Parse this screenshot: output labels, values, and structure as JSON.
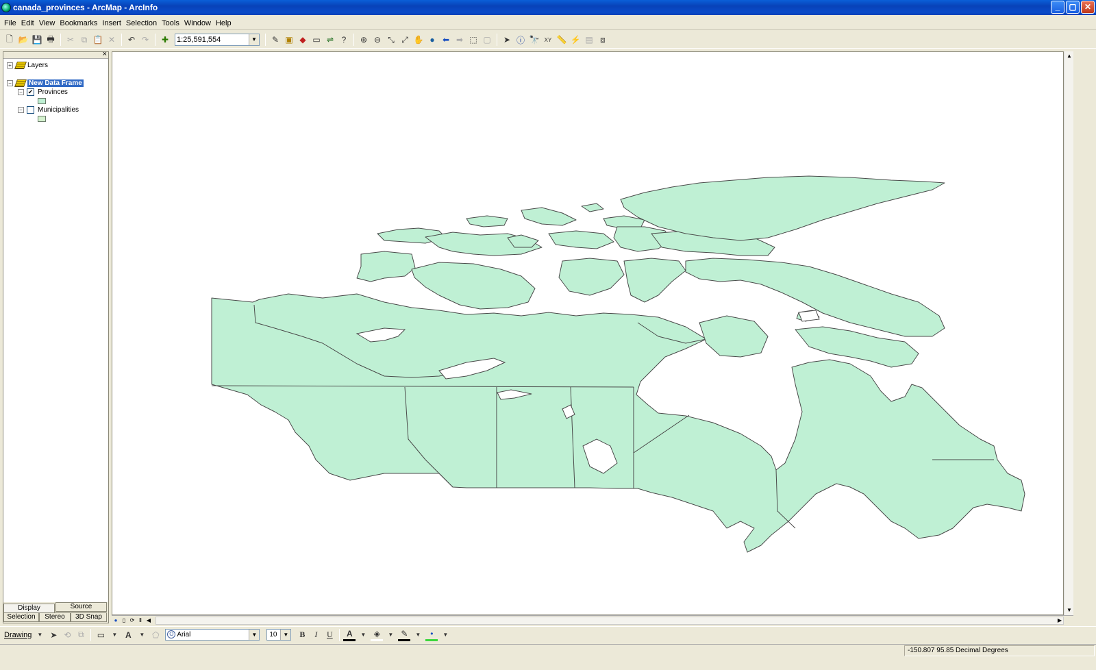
{
  "window": {
    "title": "canada_provinces - ArcMap - ArcInfo",
    "minimize": "_",
    "maximize": "▢",
    "close": "✕"
  },
  "menu": [
    "File",
    "Edit",
    "View",
    "Bookmarks",
    "Insert",
    "Selection",
    "Tools",
    "Window",
    "Help"
  ],
  "toolbar": {
    "scale": "1:25,591,554"
  },
  "toc": {
    "close_label": "×",
    "layers_group": "Layers",
    "data_frame": "New Data Frame",
    "layers": [
      {
        "name": "Provinces",
        "checked": true,
        "symbol_color": "#bff0d4"
      },
      {
        "name": "Municipalities",
        "checked": false,
        "symbol_color": "#d5f2cf"
      }
    ],
    "expand_plus": "+",
    "expand_minus": "−",
    "tabs": {
      "display": "Display",
      "source": "Source",
      "selection": "Selection",
      "stereo": "Stereo",
      "snap": "3D Snap"
    }
  },
  "map": {
    "fill_color": "#bff0d4",
    "outline_color": "#4a4a4a"
  },
  "drawing_toolbar": {
    "drawing_label": "Drawing",
    "font": "Arial",
    "font_size": "10",
    "bold": "B",
    "italic": "I",
    "underline": "U",
    "text_tool": "A"
  },
  "status": {
    "coordinates": "-150.807  95.85 Decimal Degrees"
  }
}
